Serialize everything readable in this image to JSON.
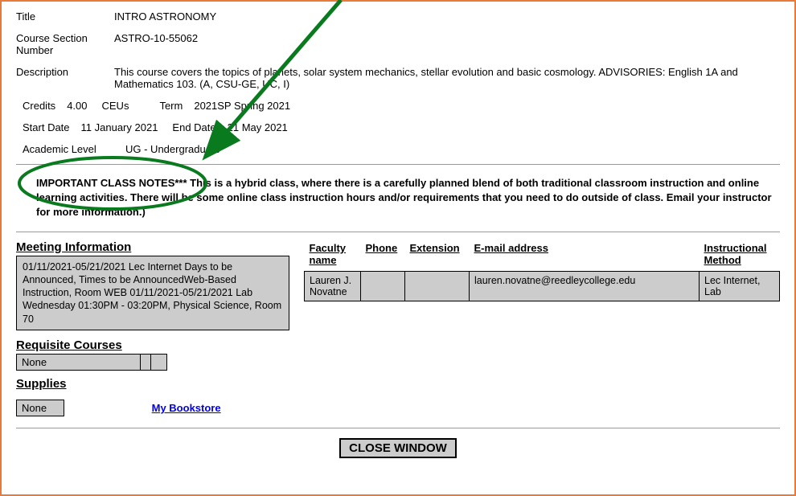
{
  "title_label": "Title",
  "title_value": "INTRO ASTRONOMY",
  "csn_label": "Course Section Number",
  "csn_value": "ASTRO-10-55062",
  "desc_label": "Description",
  "desc_value": "This course covers the topics of planets, solar system mechanics, stellar evolution and basic cosmology. ADVISORIES: English 1A and Mathematics 103. (A, CSU-GE, UC, I)",
  "credits_label": "Credits",
  "credits_value": "4.00",
  "ceus_label": "CEUs",
  "ceus_value": "",
  "term_label": "Term",
  "term_value": "2021SP Spring 2021",
  "start_label": "Start Date",
  "start_value": "11 January 2021",
  "end_label": "End Date",
  "end_value": "21 May 2021",
  "aclevel_label": "Academic Level",
  "aclevel_value": "UG - Undergraduate",
  "notes_text": "IMPORTANT CLASS NOTES*** This is a hybrid class, where there is a carefully planned blend of both traditional classroom instruction and online learning activities.  There will be some online class instruction hours and/or requirements that you need to do outside of class. Email your instructor for more information.)",
  "meeting_heading": "Meeting Information",
  "meeting_text": "01/11/2021-05/21/2021 Lec Internet Days to be Announced, Times to be AnnouncedWeb-Based Instruction, Room WEB 01/11/2021-05/21/2021 Lab Wednesday 01:30PM - 03:20PM, Physical Science, Room 70",
  "req_heading": "Requisite Courses",
  "req_value": "None",
  "supplies_heading": "Supplies",
  "supplies_value": "None",
  "bookstore_label": "My Bookstore",
  "faculty_headers": {
    "name": "Faculty name",
    "phone": "Phone",
    "ext": "Extension",
    "email": "E-mail address",
    "method": "Instructional Method"
  },
  "faculty_row": {
    "name": "Lauren J. Novatne",
    "phone": "",
    "ext": "",
    "email": "lauren.novatne@reedleycollege.edu",
    "method": "Lec Internet, Lab"
  },
  "close_label": "CLOSE WINDOW"
}
